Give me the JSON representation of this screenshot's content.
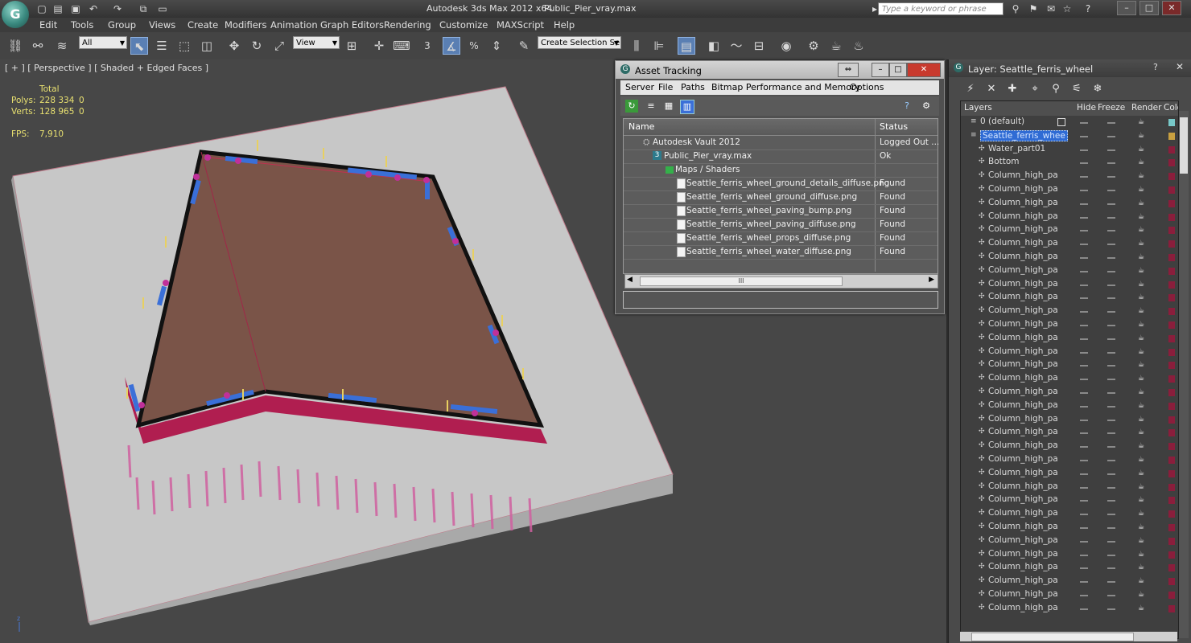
{
  "titlebar": {
    "app_title": "Autodesk 3ds Max  2012 x64",
    "file_title": "Public_Pier_vray.max",
    "search_placeholder": "Type a keyword or phrase"
  },
  "menu": [
    "Edit",
    "Tools",
    "Group",
    "Views",
    "Create",
    "Modifiers",
    "Animation",
    "Graph Editors",
    "Rendering",
    "Customize",
    "MAXScript",
    "Help"
  ],
  "toolbar": {
    "selection_filter": "All",
    "reference_coord": "View",
    "named_selection": "Create Selection Se",
    "snap_label": "3",
    "percent_snap": "%"
  },
  "viewport": {
    "label": "[ + ] [ Perspective ] [ Shaded + Edged Faces ]",
    "stats_total": "Total",
    "polys_label": "Polys:",
    "polys_value": "228 334",
    "polys_sel": "0",
    "verts_label": "Verts:",
    "verts_value": "128 965",
    "verts_sel": "0",
    "fps_label": "FPS:",
    "fps_value": "7,910"
  },
  "asset_tracking": {
    "title": "Asset Tracking",
    "menus": [
      "Server",
      "File",
      "Paths",
      "Bitmap Performance and Memory",
      "Options"
    ],
    "col_name": "Name",
    "col_status": "Status",
    "rows": [
      {
        "name": "Autodesk Vault 2012",
        "status": "Logged Out ...",
        "icon": "vault-icon"
      },
      {
        "name": "Public_Pier_vray.max",
        "status": "Ok",
        "icon": "max-file-icon"
      },
      {
        "name": "Maps / Shaders",
        "status": "",
        "icon": "maps-icon"
      },
      {
        "name": "Seattle_ferris_wheel_ground_details_diffuse.png",
        "status": "Found",
        "icon": "image-file-icon"
      },
      {
        "name": "Seattle_ferris_wheel_ground_diffuse.png",
        "status": "Found",
        "icon": "image-file-icon"
      },
      {
        "name": "Seattle_ferris_wheel_paving_bump.png",
        "status": "Found",
        "icon": "image-file-icon"
      },
      {
        "name": "Seattle_ferris_wheel_paving_diffuse.png",
        "status": "Found",
        "icon": "image-file-icon"
      },
      {
        "name": "Seattle_ferris_wheel_props_diffuse.png",
        "status": "Found",
        "icon": "image-file-icon"
      },
      {
        "name": "Seattle_ferris_wheel_water_diffuse.png",
        "status": "Found",
        "icon": "image-file-icon"
      }
    ],
    "scroll_grip": "III"
  },
  "layer_panel": {
    "title": "Layer: Seattle_ferris_wheel",
    "col_layers": "Layers",
    "col_hide": "Hide",
    "col_freeze": "Freeze",
    "col_render": "Render",
    "col_color": "Colo",
    "rows": [
      {
        "name": "0 (default)",
        "kind": "layer",
        "color": "#78c8c8"
      },
      {
        "name": "Seattle_ferris_whee",
        "kind": "layer-active",
        "color": "#c8a040"
      },
      {
        "name": "Water_part01",
        "kind": "object",
        "color": "#8a1e3c"
      },
      {
        "name": "Bottom",
        "kind": "object",
        "color": "#8a1e3c"
      },
      {
        "name": "Column_high_pa",
        "kind": "object",
        "color": "#8a1e3c"
      },
      {
        "name": "Column_high_pa",
        "kind": "object",
        "color": "#8a1e3c"
      },
      {
        "name": "Column_high_pa",
        "kind": "object",
        "color": "#8a1e3c"
      },
      {
        "name": "Column_high_pa",
        "kind": "object",
        "color": "#8a1e3c"
      },
      {
        "name": "Column_high_pa",
        "kind": "object",
        "color": "#8a1e3c"
      },
      {
        "name": "Column_high_pa",
        "kind": "object",
        "color": "#8a1e3c"
      },
      {
        "name": "Column_high_pa",
        "kind": "object",
        "color": "#8a1e3c"
      },
      {
        "name": "Column_high_pa",
        "kind": "object",
        "color": "#8a1e3c"
      },
      {
        "name": "Column_high_pa",
        "kind": "object",
        "color": "#8a1e3c"
      },
      {
        "name": "Column_high_pa",
        "kind": "object",
        "color": "#8a1e3c"
      },
      {
        "name": "Column_high_pa",
        "kind": "object",
        "color": "#8a1e3c"
      },
      {
        "name": "Column_high_pa",
        "kind": "object",
        "color": "#8a1e3c"
      },
      {
        "name": "Column_high_pa",
        "kind": "object",
        "color": "#8a1e3c"
      },
      {
        "name": "Column_high_pa",
        "kind": "object",
        "color": "#8a1e3c"
      },
      {
        "name": "Column_high_pa",
        "kind": "object",
        "color": "#8a1e3c"
      },
      {
        "name": "Column_high_pa",
        "kind": "object",
        "color": "#8a1e3c"
      },
      {
        "name": "Column_high_pa",
        "kind": "object",
        "color": "#8a1e3c"
      },
      {
        "name": "Column_high_pa",
        "kind": "object",
        "color": "#8a1e3c"
      },
      {
        "name": "Column_high_pa",
        "kind": "object",
        "color": "#8a1e3c"
      },
      {
        "name": "Column_high_pa",
        "kind": "object",
        "color": "#8a1e3c"
      },
      {
        "name": "Column_high_pa",
        "kind": "object",
        "color": "#8a1e3c"
      },
      {
        "name": "Column_high_pa",
        "kind": "object",
        "color": "#8a1e3c"
      },
      {
        "name": "Column_high_pa",
        "kind": "object",
        "color": "#8a1e3c"
      },
      {
        "name": "Column_high_pa",
        "kind": "object",
        "color": "#8a1e3c"
      },
      {
        "name": "Column_high_pa",
        "kind": "object",
        "color": "#8a1e3c"
      },
      {
        "name": "Column_high_pa",
        "kind": "object",
        "color": "#8a1e3c"
      },
      {
        "name": "Column_high_pa",
        "kind": "object",
        "color": "#8a1e3c"
      },
      {
        "name": "Column_high_pa",
        "kind": "object",
        "color": "#8a1e3c"
      },
      {
        "name": "Column_high_pa",
        "kind": "object",
        "color": "#8a1e3c"
      },
      {
        "name": "Column_high_pa",
        "kind": "object",
        "color": "#8a1e3c"
      },
      {
        "name": "Column_high_pa",
        "kind": "object",
        "color": "#8a1e3c"
      },
      {
        "name": "Column_high_pa",
        "kind": "object",
        "color": "#8a1e3c"
      },
      {
        "name": "Column_high_pa",
        "kind": "object",
        "color": "#8a1e3c"
      }
    ]
  },
  "colors": {
    "accent": "#5a7fb3",
    "selection": "#3a6fd8",
    "deck": "#7a5448",
    "pier": "#b01e50"
  }
}
